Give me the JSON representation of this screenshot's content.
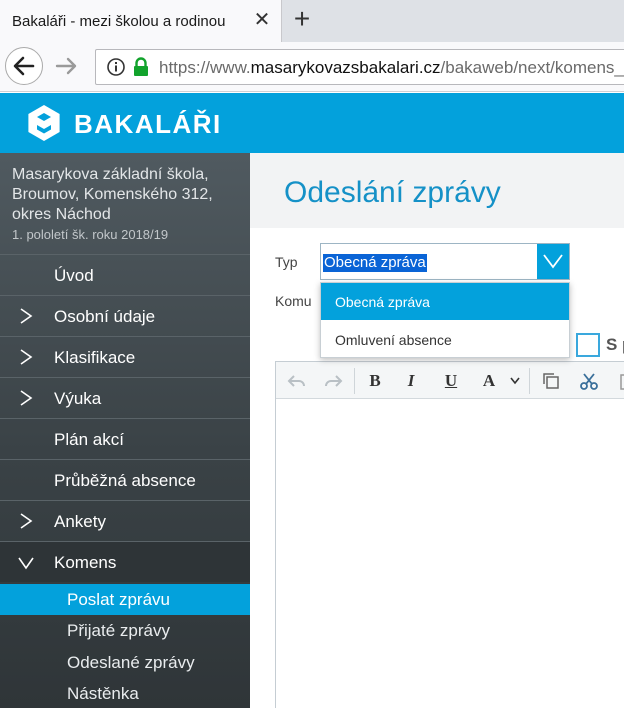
{
  "browser": {
    "tab_title": "Bakaláři - mezi školou a rodinou",
    "close_glyph": "✕",
    "new_tab_glyph": "+",
    "url_prefix": "https://www.",
    "url_host": "masarykovazsbakalari.cz",
    "url_path": "/bakaweb/next/komens_"
  },
  "app": {
    "brand": "BAKALÁŘI",
    "brand_color": "#03a1dc"
  },
  "sidebar": {
    "school_lines": [
      "Masarykova základní škola,",
      "Broumov, Komenského 312,",
      "okres Náchod"
    ],
    "term": "1. pololetí šk. roku 2018/19",
    "items": [
      {
        "label": "Úvod",
        "expandable": false
      },
      {
        "label": "Osobní údaje",
        "expandable": true
      },
      {
        "label": "Klasifikace",
        "expandable": true
      },
      {
        "label": "Výuka",
        "expandable": true
      },
      {
        "label": "Plán akcí",
        "expandable": false
      },
      {
        "label": "Průběžná absence",
        "expandable": false
      },
      {
        "label": "Ankety",
        "expandable": true
      },
      {
        "label": "Komens",
        "expandable": true,
        "expanded": true
      }
    ],
    "subitems": [
      {
        "label": "Poslat zprávu",
        "active": true
      },
      {
        "label": "Přijaté zprávy"
      },
      {
        "label": "Odeslané zprávy"
      },
      {
        "label": "Nástěnka"
      }
    ]
  },
  "main": {
    "title": "Odeslání zprávy",
    "typ_label": "Typ",
    "komu_label": "Komu",
    "type_value": "Obecná zpráva",
    "type_options": [
      "Obecná zpráva",
      "Omluvení absence"
    ],
    "checkbox_label": "S p"
  },
  "toolbar": {
    "bold": "B",
    "italic": "I",
    "underline": "U",
    "font_color": "A"
  }
}
